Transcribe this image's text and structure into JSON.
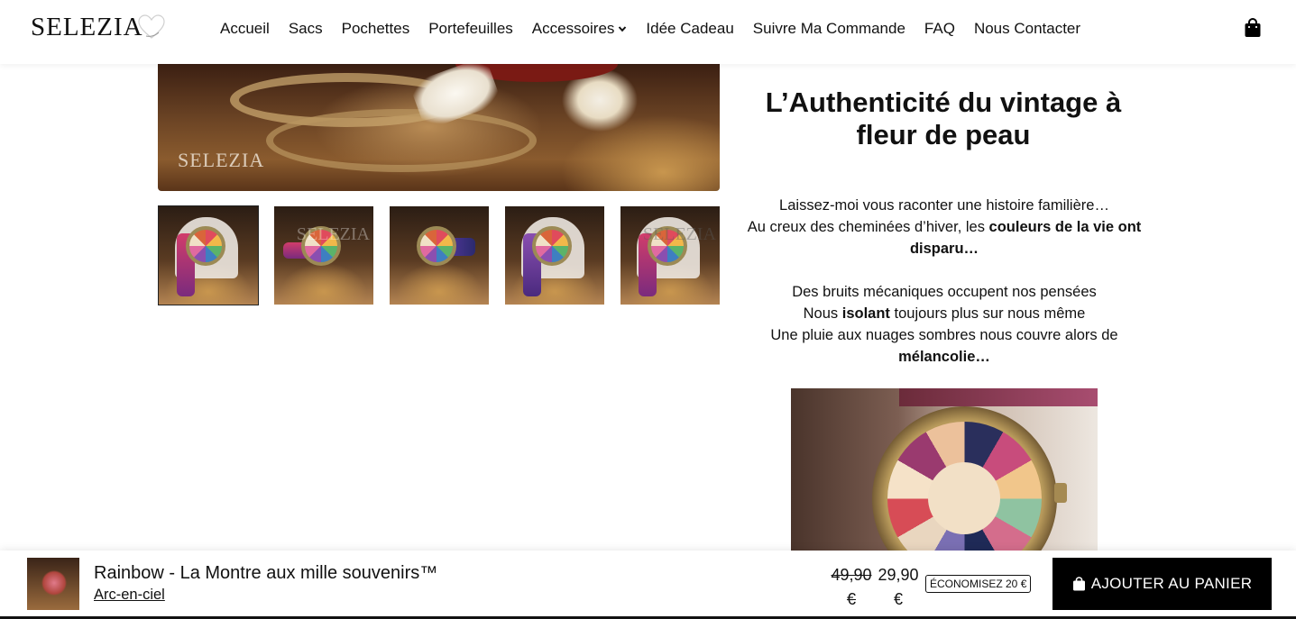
{
  "header": {
    "logo": "SELEZIA",
    "nav": [
      {
        "label": "Accueil"
      },
      {
        "label": "Sacs"
      },
      {
        "label": "Pochettes"
      },
      {
        "label": "Portefeuilles"
      },
      {
        "label": "Accessoires",
        "has_dropdown": true
      },
      {
        "label": "Idée Cadeau"
      },
      {
        "label": "Suivre Ma Commande"
      },
      {
        "label": "FAQ"
      },
      {
        "label": "Nous Contacter"
      }
    ],
    "cart_icon": "shopping-bag-icon"
  },
  "gallery": {
    "main_watermark": "SELEZIA",
    "thumbnail_count": 5,
    "active_thumbnail": 1,
    "thumbnail_watermark": "SELEZIA"
  },
  "content": {
    "headline": "L’Authenticité du vintage à fleur de peau",
    "para1": {
      "line1": "Laissez-moi vous raconter une histoire familière…",
      "line2_pre": "Au creux des cheminées d’hiver, les ",
      "line2_bold": "couleurs de la vie ont disparu…"
    },
    "para2": {
      "line1": "Des bruits mécaniques occupent nos pensées",
      "line2_pre": "Nous ",
      "line2_bold": "isolant",
      "line2_post": " toujours plus sur nous même",
      "line3": "Une pluie aux nuages sombres nous couvre alors de ",
      "line3_bold": "mélancolie…"
    }
  },
  "sticky_bar": {
    "product_title": "Rainbow - La Montre aux mille souvenirs™",
    "variant": "Arc-en-ciel",
    "old_price": "49,90 €",
    "new_price": "29,90 €",
    "savings_badge": "ÉCONOMISEZ 20 €",
    "add_to_cart": "AJOUTER AU PANIER"
  },
  "colors": {
    "text": "#111111",
    "button_bg": "#000000",
    "button_text": "#ffffff",
    "background": "#ffffff"
  }
}
